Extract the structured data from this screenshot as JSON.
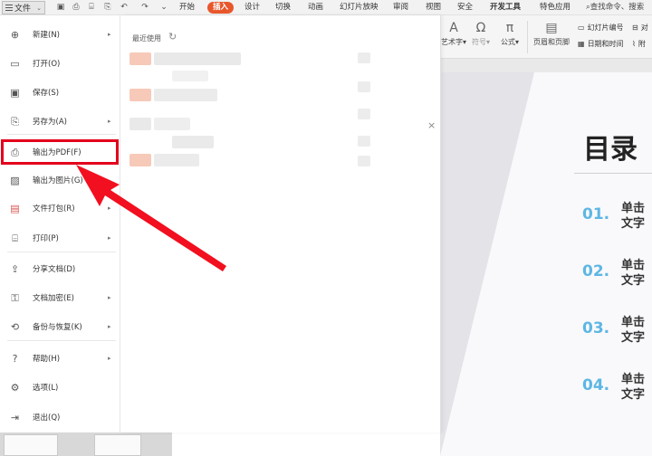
{
  "topbar": {
    "file_label": "文件",
    "tabs": [
      "开始",
      "插入",
      "设计",
      "切换",
      "动画",
      "幻灯片放映",
      "审阅",
      "视图",
      "安全",
      "开发工具",
      "特色应用"
    ],
    "active_tab": "插入",
    "search_placeholder": "查找命令、搜索"
  },
  "ribbon": {
    "art_label": "艺术字",
    "symbol_label": "符号",
    "formula_label": "公式",
    "header_footer_label": "页眉和页脚",
    "slide_number_label": "幻灯片编号",
    "datetime_label": "日期和时间",
    "object_label": "对",
    "attach_label": "附"
  },
  "menu": {
    "items": [
      {
        "label": "新建(N)",
        "icon": "new-doc-icon",
        "has_submenu": true
      },
      {
        "label": "打开(O)",
        "icon": "folder-open-icon",
        "has_submenu": false
      },
      {
        "label": "保存(S)",
        "icon": "save-icon",
        "has_submenu": false
      },
      {
        "label": "另存为(A)",
        "icon": "save-as-icon",
        "has_submenu": true
      },
      {
        "label": "输出为PDF(F)",
        "icon": "export-pdf-icon",
        "has_submenu": false
      },
      {
        "label": "输出为图片(G)",
        "icon": "export-image-icon",
        "has_submenu": false
      },
      {
        "label": "文件打包(R)",
        "icon": "package-icon",
        "has_submenu": true
      },
      {
        "label": "打印(P)",
        "icon": "print-icon",
        "has_submenu": true
      },
      {
        "label": "分享文档(D)",
        "icon": "share-icon",
        "has_submenu": false
      },
      {
        "label": "文档加密(E)",
        "icon": "encrypt-icon",
        "has_submenu": true
      },
      {
        "label": "备份与恢复(K)",
        "icon": "backup-icon",
        "has_submenu": true
      },
      {
        "label": "帮助(H)",
        "icon": "help-icon",
        "has_submenu": true
      },
      {
        "label": "选项(L)",
        "icon": "options-gear-icon",
        "has_submenu": false
      },
      {
        "label": "退出(Q)",
        "icon": "exit-icon",
        "has_submenu": false
      }
    ]
  },
  "recent": {
    "title": "最近使用"
  },
  "slide": {
    "title": "目录",
    "toc": [
      {
        "num": "01.",
        "line1": "单击",
        "line2": "文字"
      },
      {
        "num": "02.",
        "line1": "单击",
        "line2": "文字"
      },
      {
        "num": "03.",
        "line1": "单击",
        "line2": "文字"
      },
      {
        "num": "04.",
        "line1": "单击",
        "line2": "文字"
      }
    ]
  },
  "colors": {
    "accent_tab": "#e8572c",
    "highlight_red": "#e4001b",
    "toc_blue": "#5eb6e4"
  }
}
